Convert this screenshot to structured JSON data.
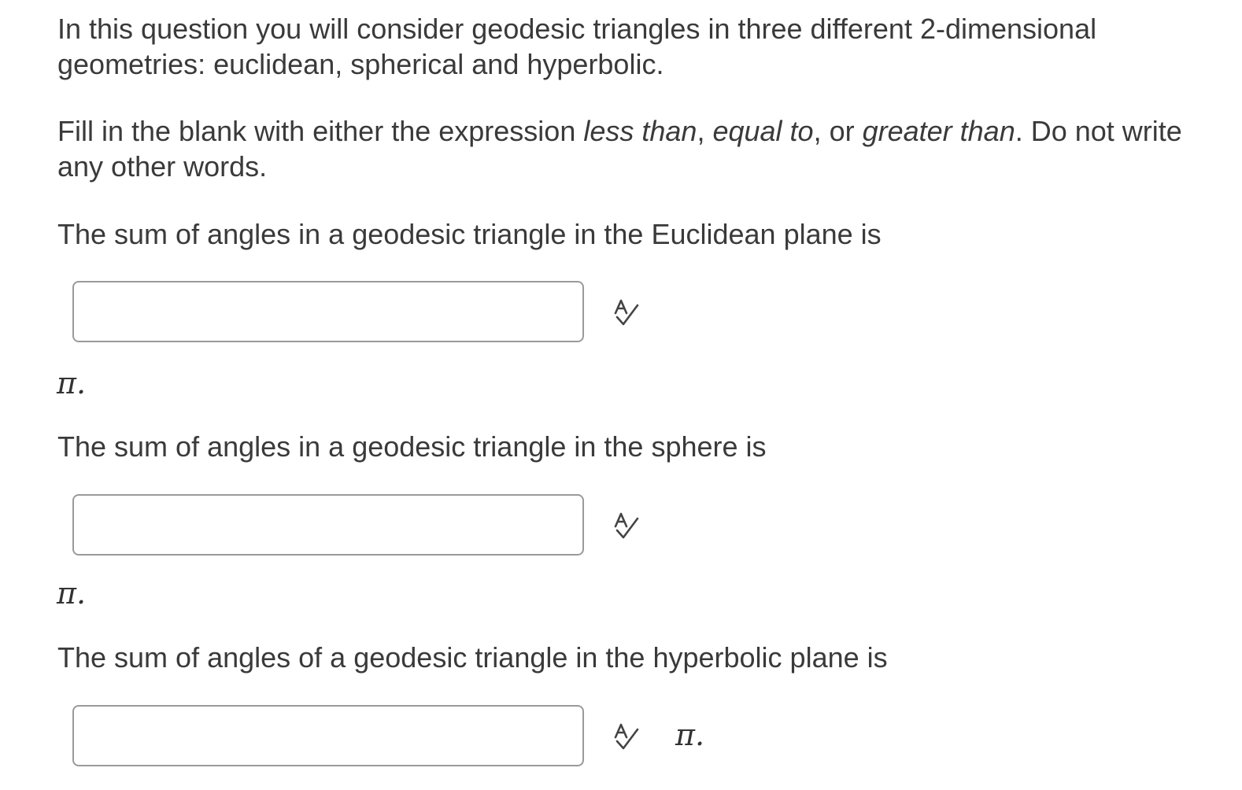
{
  "intro": {
    "text": "In this question you will consider geodesic triangles in three different 2-dimensional geometries: euclidean, spherical and hyperbolic."
  },
  "instructions": {
    "part1": "Fill in the blank with either the expression ",
    "option1": "less than",
    "sep1": ", ",
    "option2": "equal to",
    "sep2": ", or ",
    "option3": "greater than",
    "part2": ". Do not write any other words."
  },
  "questions": [
    {
      "prompt": "The sum of angles in a geodesic triangle in the Euclidean plane is",
      "answer_value": "",
      "suffix": "π."
    },
    {
      "prompt": "The sum of angles in a geodesic triangle in the sphere is",
      "answer_value": "",
      "suffix": "π."
    },
    {
      "prompt": "The sum of angles of a geodesic triangle in the hyperbolic plane is",
      "answer_value": "",
      "suffix": "π."
    }
  ],
  "icons": {
    "spellcheck": "spellcheck-icon"
  },
  "colors": {
    "text": "#3a3a3a",
    "input_border": "#9a9a9a",
    "icon": "#444444"
  }
}
